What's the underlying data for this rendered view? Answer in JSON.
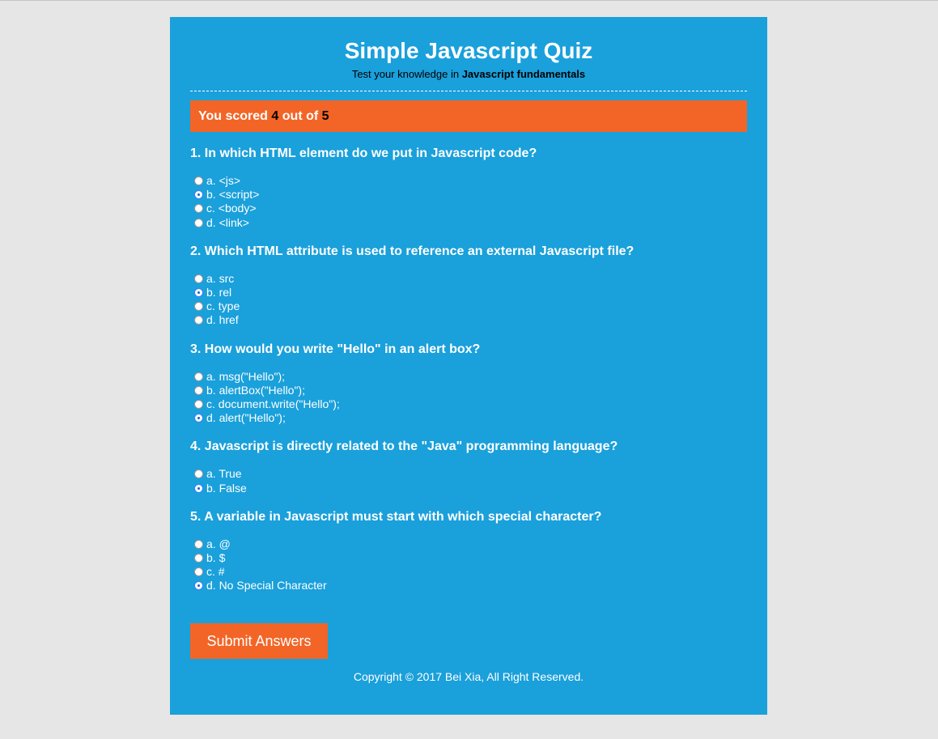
{
  "header": {
    "title": "Simple Javascript Quiz",
    "subtitle_prefix": "Test your knowledge in",
    "subtitle_bold": "Javascript fundamentals"
  },
  "score": {
    "prefix": "You scored",
    "scored": "4",
    "middle": "out of",
    "total": "5"
  },
  "questions": [
    {
      "text": "1. In which HTML element do we put in Javascript code?",
      "options": [
        "a. <js>",
        "b. <script>",
        "c. <body>",
        "d. <link>"
      ],
      "selected": 1
    },
    {
      "text": "2. Which HTML attribute is used to reference an external Javascript file?",
      "options": [
        "a. src",
        "b. rel",
        "c. type",
        "d. href"
      ],
      "selected": 1
    },
    {
      "text": "3. How would you write \"Hello\" in an alert box?",
      "options": [
        "a. msg(\"Hello\");",
        "b. alertBox(\"Hello\");",
        "c. document.write(\"Hello\");",
        "d. alert(\"Hello\");"
      ],
      "selected": 3
    },
    {
      "text": "4. Javascript is directly related to the \"Java\" programming language?",
      "options": [
        "a. True",
        "b. False"
      ],
      "selected": 1
    },
    {
      "text": "5. A variable in Javascript must start with which special character?",
      "options": [
        "a. @",
        "b. $",
        "c. #",
        "d. No Special Character"
      ],
      "selected": 3
    }
  ],
  "submit_label": "Submit Answers",
  "footer": "Copyright © 2017 Bei Xia, All Right Reserved.",
  "colors": {
    "panel": "#1aa0db",
    "accent": "#f26527",
    "background": "#e6e6e6"
  }
}
